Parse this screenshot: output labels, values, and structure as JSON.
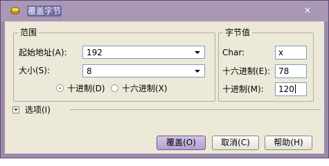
{
  "window": {
    "title": "覆盖字节",
    "icon": "app-icon",
    "close_glyph": "×"
  },
  "range_group": {
    "legend": "范围",
    "start_label": "起始地址(A):",
    "start_value": "192",
    "size_label": "大小(S):",
    "size_value": "8",
    "radio_decimal": "十进制(D)",
    "radio_hex": "十六进制(X)",
    "selected_radio": "decimal"
  },
  "byte_group": {
    "legend": "字节值",
    "char_label": "Char:",
    "char_value": "x",
    "hex_label": "十六进制(E):",
    "hex_value": "78",
    "dec_label": "十进制(M):",
    "dec_value": "120"
  },
  "options": {
    "label": "选项(I)"
  },
  "buttons": {
    "overwrite": "覆盖(O)",
    "cancel": "取消(C)",
    "help": "帮助(H)"
  },
  "colors": {
    "titlebar": "#a898b5",
    "title_highlight": "#6f6aa3",
    "dialog_bg": "#ece9d8",
    "default_button": "#b39fd0"
  }
}
